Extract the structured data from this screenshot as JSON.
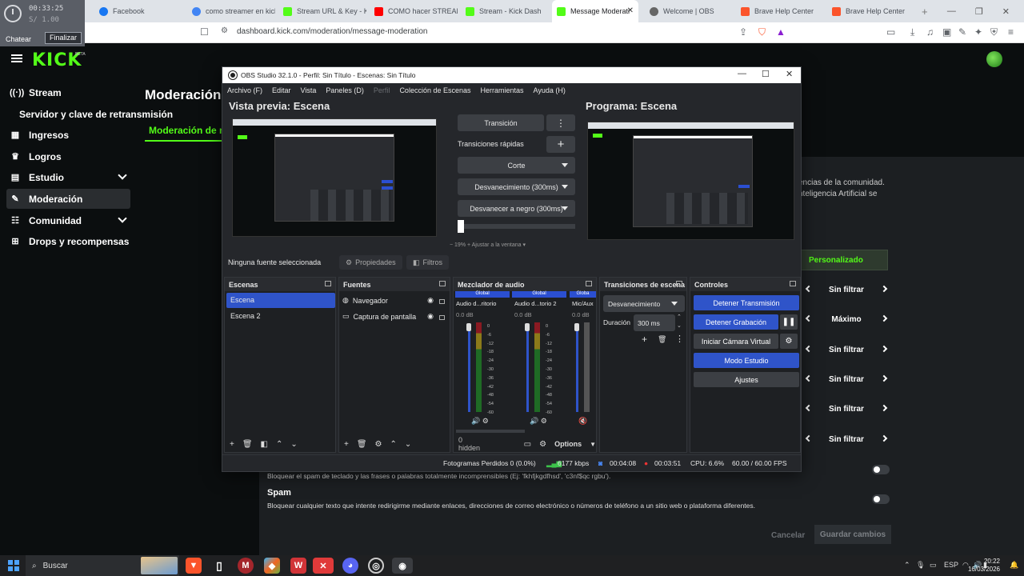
{
  "recorder": {
    "time": "00:33:25",
    "sub": "S/ 1.00",
    "chat_label": "Chatear",
    "finish_label": "Finalizar"
  },
  "tabs": [
    {
      "label": "Facebook",
      "color": "#1877f2"
    },
    {
      "label": "como streamer en kick",
      "color": "#4285f4"
    },
    {
      "label": "Stream URL & Key - Ki",
      "color": "#53fc18"
    },
    {
      "label": "COMO hacer STREAM",
      "color": "#ff0000"
    },
    {
      "label": "Stream - Kick Dash",
      "color": "#53fc18"
    },
    {
      "label": "Message Moderati",
      "color": "#53fc18",
      "active": true
    },
    {
      "label": "Welcome | OBS",
      "color": "#666666"
    },
    {
      "label": "Brave Help Center",
      "color": "#fb542b"
    },
    {
      "label": "Brave Help Center",
      "color": "#fb542b"
    }
  ],
  "address": {
    "url": "dashboard.kick.com/moderation/message-moderation"
  },
  "kick": {
    "logo": "KICK",
    "beta": "BETA",
    "sidebar": [
      {
        "label": "Stream",
        "icon": "stream-icon"
      },
      {
        "label": "Servidor y clave de retransmisión",
        "sub": true
      },
      {
        "label": "Ingresos",
        "icon": "wallet-icon"
      },
      {
        "label": "Logros",
        "icon": "trophy-icon"
      },
      {
        "label": "Estudio",
        "icon": "studio-icon",
        "chevron": true
      },
      {
        "label": "Moderación",
        "icon": "wrench-icon",
        "active": true
      },
      {
        "label": "Comunidad",
        "icon": "community-icon",
        "chevron": true
      },
      {
        "label": "Drops y recompensas",
        "icon": "gift-icon"
      }
    ],
    "page_title": "Moderación",
    "page_tab": "Moderación de mensajes",
    "desc_line1": "encias de la comunidad.",
    "desc_line2": "nteligencia Artificial se",
    "custom_button": "Personalizado",
    "filters": [
      "Sin filtrar",
      "Máximo",
      "Sin filtrar",
      "Sin filtrar",
      "Sin filtrar",
      "Sin filtrar"
    ],
    "rule_gibberish_text": "Bloquear el spam de teclado y las frases o palabras totalmente incomprensibles (Ej: 'fkhfjkgdfhsd', 'c3nf$qc rgbu').",
    "rule_spam_title": "Spam",
    "rule_spam_text": "Bloquear cualquier texto que intente redirigirme mediante enlaces, direcciones de correo electrónico o números de teléfono a un sitio web o plataforma diferentes.",
    "cancel": "Cancelar",
    "save": "Guardar cambios"
  },
  "obs": {
    "title": "OBS Studio 32.1.0 - Perfil: Sin Título - Escenas: Sin Título",
    "menu": [
      "Archivo (F)",
      "Editar",
      "Vista",
      "Paneles (D)",
      "Perfil",
      "Colección de Escenas",
      "Herramientas",
      "Ayuda (H)"
    ],
    "preview_title": "Vista previa: Escena",
    "program_title": "Programa: Escena",
    "zoom": "−   19%   +   Ajustar a la ventana  ▾",
    "transition": "Transición",
    "quick_transitions": "Transiciones rápidas",
    "cut": "Corte",
    "fade": "Desvanecimiento (300ms)",
    "fade_black": "Desvanecer a negro (300ms)",
    "no_source": "Ninguna fuente seleccionada",
    "properties": "Propiedades",
    "filters": "Filtros",
    "scenes_title": "Escenas",
    "scenes": [
      "Escena",
      "Escena 2"
    ],
    "sources_title": "Fuentes",
    "sources": [
      "Navegador",
      "Captura de pantalla"
    ],
    "mixer_title": "Mezclador de audio",
    "mixer": [
      {
        "tag": "Global",
        "name": "Audio d...ritorio",
        "db": "0.0 dB"
      },
      {
        "tag": "Global",
        "name": "Audio d...torio 2",
        "db": "0.0 dB"
      },
      {
        "tag": "Globa",
        "name": "Mic/Aux",
        "db": "0.0 dB"
      }
    ],
    "scale": [
      "0",
      "-6",
      "-12",
      "-18",
      "-24",
      "-30",
      "-36",
      "-42",
      "-48",
      "-54",
      "-60"
    ],
    "hidden": "0 hidden",
    "options": "Options",
    "transitions_title": "Transiciones de escena",
    "transition_select": "Desvanecimiento",
    "duration_label": "Duración",
    "duration_value": "300 ms",
    "controls_title": "Controles",
    "controls": [
      "Detener Transmisión",
      "Detener Grabación",
      "Iniciar Cámara Virtual",
      "Modo Estudio",
      "Ajustes"
    ],
    "status": {
      "dropped": "Fotogramas Perdidos 0 (0.0%)",
      "kbps": "6177 kbps",
      "stream_time": "00:04:08",
      "rec_time": "00:03:51",
      "cpu": "CPU: 6.6%",
      "fps": "60.00 / 60.00 FPS"
    }
  },
  "taskbar": {
    "search": "Buscar",
    "lang": "ESP",
    "time": "20:22",
    "date": "16/03/2026"
  }
}
